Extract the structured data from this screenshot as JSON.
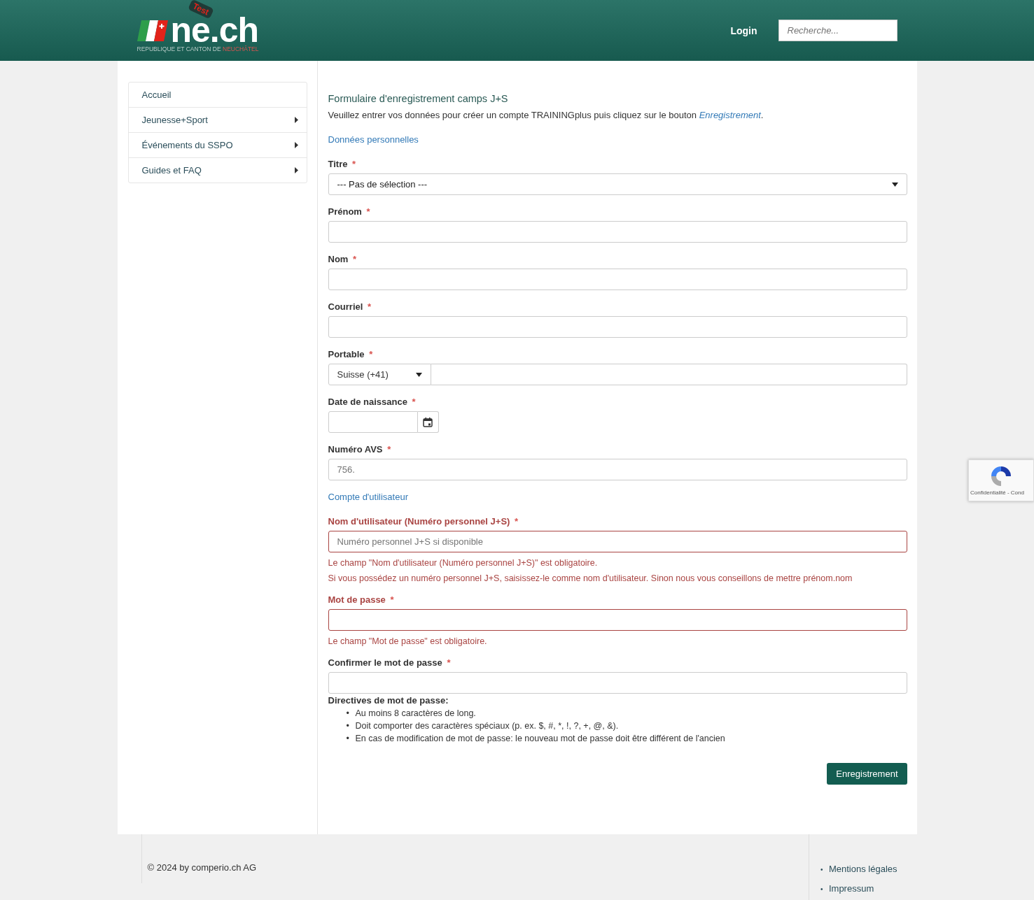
{
  "header": {
    "logo": {
      "text": "ne.ch",
      "badge": "Test",
      "subtitle": "REPUBLIQUE ET CANTON DE",
      "subtitle_highlight": "NEUCHÂTEL"
    },
    "login": "Login",
    "search": {
      "placeholder": "Recherche..."
    }
  },
  "sidebar": {
    "items": [
      {
        "label": "Accueil",
        "has_submenu": false
      },
      {
        "label": "Jeunesse+Sport",
        "has_submenu": true
      },
      {
        "label": "Événements du SSPO",
        "has_submenu": true
      },
      {
        "label": "Guides et FAQ",
        "has_submenu": true
      }
    ]
  },
  "form": {
    "title": "Formulaire d'enregistrement camps J+S",
    "intro": "Veuillez entrer vos données pour créer un compte TRAININGplus puis cliquez sur le bouton *Enregistrement*.",
    "sections": [
      {
        "title": "Données personnelles",
        "fields": [
          {
            "kind": "select",
            "label": "Titre",
            "required": true,
            "error": false,
            "value": "--- Pas de sélection ---"
          },
          {
            "kind": "text",
            "label": "Prénom",
            "required": true,
            "error": false
          },
          {
            "kind": "text",
            "label": "Nom",
            "required": true,
            "error": false
          },
          {
            "kind": "text",
            "label": "Courriel",
            "required": true,
            "error": false
          },
          {
            "kind": "phone",
            "label": "Portable",
            "required": true,
            "error": false,
            "country": "Suisse (+41)"
          },
          {
            "kind": "date",
            "label": "Date de naissance",
            "required": true,
            "error": false
          },
          {
            "kind": "text",
            "label": "Numéro AVS",
            "required": true,
            "error": false,
            "placeholder": "756."
          }
        ]
      },
      {
        "title": "Compte d'utilisateur",
        "fields": [
          {
            "kind": "text",
            "label": "Nom d'utilisateur (Numéro personnel J+S)",
            "required": true,
            "error": true,
            "placeholder": "Numéro personnel J+S si disponible",
            "messages": [
              "Le champ \"Nom d'utilisateur (Numéro personnel J+S)\" est obligatoire.",
              "Si vous possédez un numéro personnel J+S, saisissez-le comme nom d'utilisateur. Sinon nous vous conseillons de mettre prénom.nom"
            ]
          },
          {
            "kind": "password",
            "label": "Mot de passe",
            "required": true,
            "error": true,
            "messages": [
              "Le champ \"Mot de passe\" est obligatoire."
            ]
          },
          {
            "kind": "password",
            "label": "Confirmer le mot de passe",
            "required": true,
            "error": false
          }
        ]
      }
    ],
    "password_rules": {
      "title": "Directives de mot de passe:",
      "items": [
        "Au moins 8 caractères de long.",
        "Doit comporter des caractères spéciaux (p. ex. $, #, *, !, ?, +, @, &).",
        "En cas de modification de mot de passe: le nouveau mot de passe doit être différent de l'ancien"
      ]
    },
    "submit": "Enregistrement"
  },
  "required_marker": "*",
  "bullet": "•",
  "recaptcha": {
    "text": "Confidentialité - Cond"
  },
  "footer": {
    "copyright": "© 2024 by comperio.ch AG",
    "links": [
      "Mentions légales",
      "Impressum"
    ]
  }
}
